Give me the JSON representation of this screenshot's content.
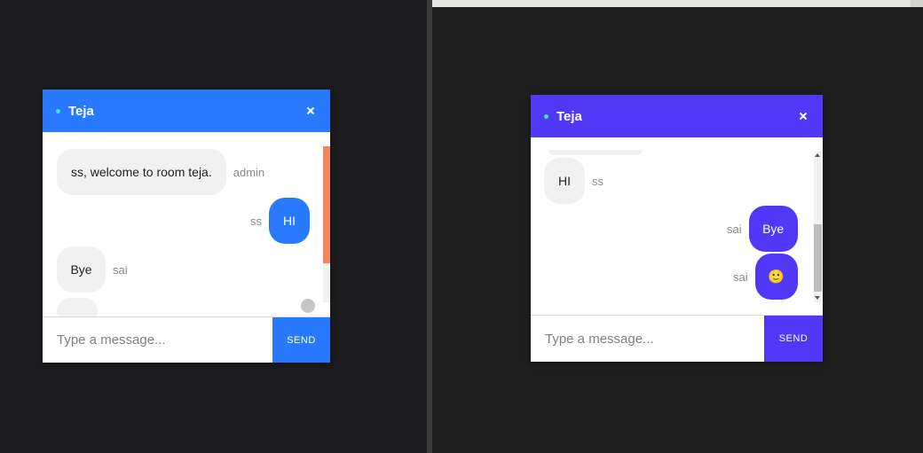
{
  "chat_left": {
    "room_name": "Teja",
    "messages": [
      {
        "text": "ss, welcome to room teja.",
        "sender": "admin"
      },
      {
        "text": "HI",
        "sender": "ss"
      },
      {
        "text": "Bye",
        "sender": "sai"
      }
    ],
    "input_placeholder": "Type a message...",
    "send_label": "SEND",
    "accent_color": "#2979ff"
  },
  "chat_right": {
    "room_name": "Teja",
    "messages": [
      {
        "text": "HI",
        "sender": "ss"
      },
      {
        "text": "Bye",
        "sender": "sai"
      },
      {
        "text": "🙂",
        "sender": "sai"
      }
    ],
    "input_placeholder": "Type a message...",
    "send_label": "SEND",
    "accent_color": "#5138f7"
  }
}
